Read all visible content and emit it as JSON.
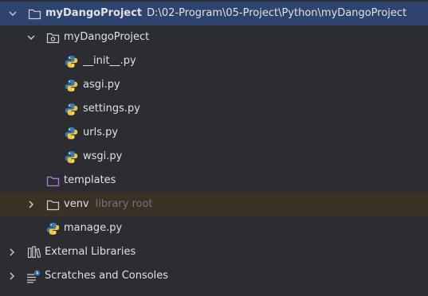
{
  "project": {
    "name": "myDangoProject",
    "path": "D:\\02-Program\\05-Project\\Python\\myDangoProject"
  },
  "package": {
    "name": "myDangoProject"
  },
  "files": [
    {
      "label": "__init__.py",
      "icon": "python-file-icon"
    },
    {
      "label": "asgi.py",
      "icon": "python-file-icon"
    },
    {
      "label": "settings.py",
      "icon": "python-file-icon"
    },
    {
      "label": "urls.py",
      "icon": "python-file-icon"
    },
    {
      "label": "wsgi.py",
      "icon": "python-file-icon"
    }
  ],
  "templates": {
    "label": "templates",
    "icon": "template-folder-icon"
  },
  "venv": {
    "label": "venv",
    "hint": "library root",
    "icon": "folder-icon"
  },
  "manage": {
    "label": "manage.py",
    "icon": "python-file-icon"
  },
  "external_libraries": {
    "label": "External Libraries",
    "icon": "library-icon"
  },
  "scratches": {
    "label": "Scratches and Consoles",
    "icon": "scratches-icon"
  },
  "colors": {
    "background": "#2b2d30",
    "selection": "#2e436e",
    "excluded_row": "#3a3124",
    "text": "#dfe1e5",
    "hint_text": "#6f737a",
    "python_blue": "#3c78b4",
    "python_yellow": "#f0c83c",
    "template_purple": "#a87fd6"
  }
}
